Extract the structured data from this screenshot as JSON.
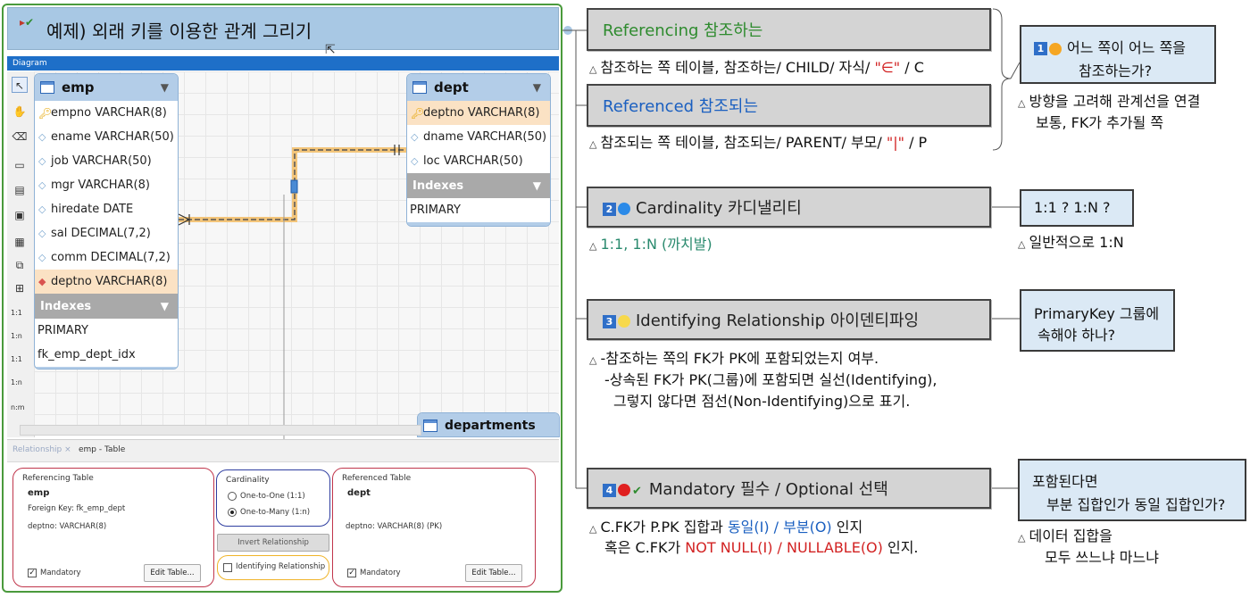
{
  "slide": {
    "title": "예제) 외래 키를 이용한 관계 그리기",
    "title_marks": "▸✔"
  },
  "diagram": {
    "bar_label": "Diagram",
    "tools": [
      "cursor",
      "hand",
      "eraser",
      "layer",
      "note",
      "image",
      "table",
      "view",
      "routine",
      "1:1",
      "1:n",
      "1:1",
      "1:n",
      "n:m"
    ],
    "tables": {
      "emp": {
        "name": "emp",
        "columns": [
          {
            "kind": "pk",
            "text": "empno VARCHAR(8)"
          },
          {
            "kind": "col",
            "text": "ename VARCHAR(50)"
          },
          {
            "kind": "col",
            "text": "job VARCHAR(50)"
          },
          {
            "kind": "col",
            "text": "mgr VARCHAR(8)"
          },
          {
            "kind": "col",
            "text": "hiredate DATE"
          },
          {
            "kind": "col",
            "text": "sal DECIMAL(7,2)"
          },
          {
            "kind": "col",
            "text": "comm DECIMAL(7,2)"
          },
          {
            "kind": "fk",
            "text": "deptno VARCHAR(8)"
          }
        ],
        "indexes_label": "Indexes",
        "indexes": [
          "PRIMARY",
          "fk_emp_dept_idx"
        ]
      },
      "dept": {
        "name": "dept",
        "columns": [
          {
            "kind": "pk",
            "text": "deptno VARCHAR(8)"
          },
          {
            "kind": "col",
            "text": "dname VARCHAR(50)"
          },
          {
            "kind": "col",
            "text": "loc VARCHAR(50)"
          }
        ],
        "indexes_label": "Indexes",
        "indexes": [
          "PRIMARY"
        ]
      },
      "departments": {
        "name": "departments"
      }
    }
  },
  "panel": {
    "tab_relationship": "Relationship ×",
    "tab_emp": "emp - Table",
    "referencing": {
      "title": "Referencing Table",
      "table": "emp",
      "fk": "Foreign Key: fk_emp_dept",
      "col": "deptno: VARCHAR(8)",
      "mandatory_label": "Mandatory",
      "mandatory_checked": true,
      "edit_button": "Edit Table..."
    },
    "cardinality": {
      "title": "Cardinality",
      "one_to_one": "One-to-One (1:1)",
      "one_to_many": "One-to-Many (1:n)",
      "selected": "one_to_many",
      "invert_button": "Invert Relationship",
      "identifying_label": "Identifying Relationship",
      "identifying_checked": false
    },
    "referenced": {
      "title": "Referenced Table",
      "table": "dept",
      "col": "deptno: VARCHAR(8) (PK)",
      "mandatory_label": "Mandatory",
      "mandatory_checked": true,
      "edit_button": "Edit Table..."
    }
  },
  "mindmap": {
    "n1": {
      "label": "Referencing 참조하는",
      "note": "참조하는 쪽 테이블, 참조하는/ CHILD/ 자식/ ",
      "note_sym": "\"∈\"",
      "note_tail": " / C"
    },
    "n2": {
      "label": "Referenced 참조되는",
      "note": "참조되는 쪽 테이블, 참조되는/ PARENT/ 부모/ ",
      "note_sym": "\"|\"",
      "note_tail": " / P"
    },
    "c1": {
      "num": "1",
      "line1": "어느 쪽이 어느 쪽을",
      "line2": "참조하는가?",
      "note1": "방향을 고려해 관계선을 연결",
      "note2": "보통, FK가 추가될 쪽"
    },
    "n3": {
      "num": "2",
      "label": "Cardinality 카디낼리티",
      "note": "1:1, 1:N (까치발)"
    },
    "c2": {
      "text": "1:1 ?  1:N ?",
      "note": "일반적으로 1:N"
    },
    "n4": {
      "num": "3",
      "label": "Identifying Relationship 아이덴티파잉",
      "note1": "-참조하는 쪽의 FK가 PK에 포함되었는지 여부.",
      "note2": "-상속된 FK가 PK(그룹)에 포함되면 실선(Identifying),",
      "note3": "그렇지 않다면 점선(Non-Identifying)으로 표기."
    },
    "c3": {
      "line1": "PrimaryKey 그룹에",
      "line2": "속해야 하나?"
    },
    "n5": {
      "num": "4",
      "label": "Mandatory 필수 / Optional 선택",
      "note1_a": "C.FK가 P.PK 집합과 ",
      "note1_b": "동일(I) / 부분(O)",
      "note1_c": " 인지",
      "note2_a": "혹은 C.FK가 ",
      "note2_b": "NOT NULL(I) / NULLABLE(O)",
      "note2_c": " 인지."
    },
    "c4": {
      "line1": "포함된다면",
      "line2": "부분 집합인가 동일 집합인가?",
      "note1": "데이터 집합을",
      "note2": "모두 쓰느냐 마느냐"
    },
    "colors": {
      "node_bg": "#d4d4d4",
      "callout_bg": "#dbe9f5",
      "green_text": "#2e8b2e",
      "blue_text": "#1a5fc0",
      "red_text": "#d22222",
      "orange_dot": "#f5a623",
      "blue_dot": "#2b8ae8",
      "yellow_dot": "#f7d94c",
      "red_dot": "#e02020"
    }
  }
}
